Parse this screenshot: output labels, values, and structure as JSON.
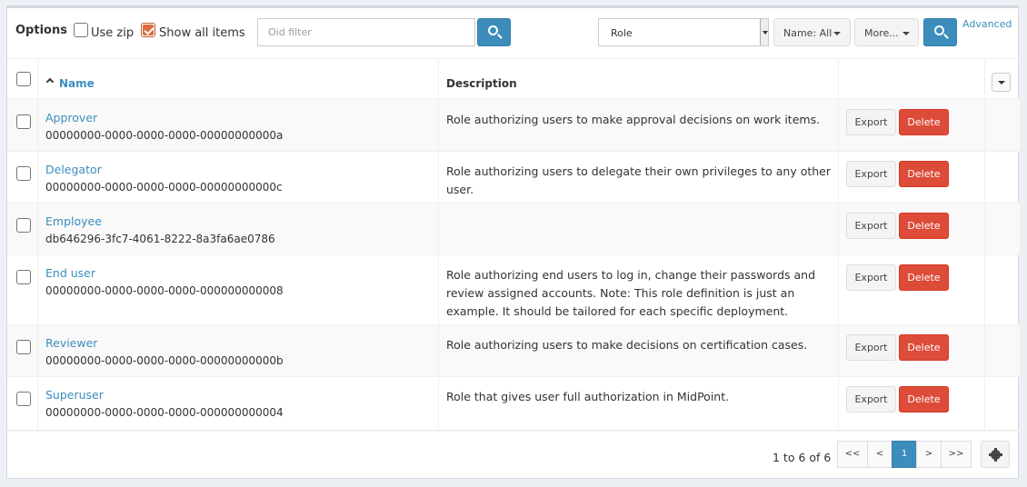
{
  "toolbar": {
    "options_label": "Options",
    "use_zip_label": "Use zip",
    "use_zip_checked": false,
    "show_all_label": "Show all items",
    "show_all_checked": true,
    "oid_filter_placeholder": "Oid filter",
    "oid_filter_value": "",
    "type_select_value": "Role",
    "name_filter_label": "Name: All",
    "more_label": "More...",
    "advanced_link": "Advanced",
    "search_icon": "search-icon"
  },
  "table": {
    "headers": {
      "name": "Name",
      "description": "Description"
    },
    "sort": {
      "column": "Name",
      "direction": "ascending"
    },
    "actions": {
      "export": "Export",
      "delete": "Delete"
    },
    "rows": [
      {
        "name": "Approver",
        "oid": "00000000-0000-0000-0000-00000000000a",
        "description": "Role authorizing users to make approval decisions on work items."
      },
      {
        "name": "Delegator",
        "oid": "00000000-0000-0000-0000-00000000000c",
        "description": "Role authorizing users to delegate their own privileges to any other user."
      },
      {
        "name": "Employee",
        "oid": "db646296-3fc7-4061-8222-8a3fa6ae0786",
        "description": ""
      },
      {
        "name": "End user",
        "oid": "00000000-0000-0000-0000-000000000008",
        "description": "Role authorizing end users to log in, change their passwords and review assigned accounts. Note: This role definition is just an example. It should be tailored for each specific deployment."
      },
      {
        "name": "Reviewer",
        "oid": "00000000-0000-0000-0000-00000000000b",
        "description": "Role authorizing users to make decisions on certification cases."
      },
      {
        "name": "Superuser",
        "oid": "00000000-0000-0000-0000-000000000004",
        "description": "Role that gives user full authorization in MidPoint."
      }
    ]
  },
  "footer": {
    "count_text": "1 to 6 of 6",
    "pagination": [
      "<<",
      "<",
      "1",
      ">",
      ">>"
    ],
    "current_page": "1"
  },
  "colors": {
    "accent": "#3c8dbc",
    "danger": "#dd4b39",
    "checkbox_checked": "#dd6b3c"
  }
}
